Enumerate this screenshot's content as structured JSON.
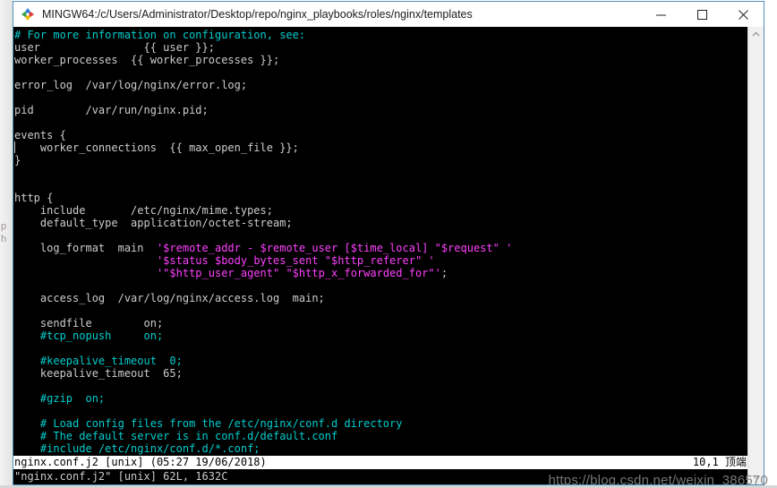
{
  "window": {
    "title": "MINGW64:/c/Users/Administrator/Desktop/repo/nginx_playbooks/roles/nginx/templates",
    "app_icon": "mintty-icon",
    "controls": {
      "minimize": "minimize-button",
      "maximize": "maximize-button",
      "close": "close-button"
    },
    "accent_border": "#4e90b5"
  },
  "terminal": {
    "background": "#000000",
    "foreground": "#cccccc",
    "comment_color": "#00cdcd",
    "string_color": "#ff40ff",
    "cursor": {
      "line": 10,
      "column": 1
    },
    "lines": [
      {
        "n": 1,
        "segments": [
          {
            "t": "# For more information on configuration, see:",
            "c": "comment"
          }
        ]
      },
      {
        "n": 2,
        "segments": [
          {
            "t": "user                {{ user }};",
            "c": "text"
          }
        ]
      },
      {
        "n": 3,
        "segments": [
          {
            "t": "worker_processes  {{ worker_processes }};",
            "c": "text"
          }
        ]
      },
      {
        "n": 4,
        "segments": [
          {
            "t": "",
            "c": "text"
          }
        ]
      },
      {
        "n": 5,
        "segments": [
          {
            "t": "error_log  /var/log/nginx/error.log;",
            "c": "text"
          }
        ]
      },
      {
        "n": 6,
        "segments": [
          {
            "t": "",
            "c": "text"
          }
        ]
      },
      {
        "n": 7,
        "segments": [
          {
            "t": "pid        /var/run/nginx.pid;",
            "c": "text"
          }
        ]
      },
      {
        "n": 8,
        "segments": [
          {
            "t": "",
            "c": "text"
          }
        ]
      },
      {
        "n": 9,
        "segments": [
          {
            "t": "events {",
            "c": "text"
          }
        ]
      },
      {
        "n": 10,
        "segments": [
          {
            "t": "    worker_connections  {{ max_open_file }};",
            "c": "text"
          }
        ]
      },
      {
        "n": 11,
        "segments": [
          {
            "t": "}",
            "c": "text"
          }
        ]
      },
      {
        "n": 12,
        "segments": [
          {
            "t": "",
            "c": "text"
          }
        ]
      },
      {
        "n": 13,
        "segments": [
          {
            "t": "",
            "c": "text"
          }
        ]
      },
      {
        "n": 14,
        "segments": [
          {
            "t": "http {",
            "c": "text"
          }
        ]
      },
      {
        "n": 15,
        "segments": [
          {
            "t": "    include       /etc/nginx/mime.types;",
            "c": "text"
          }
        ]
      },
      {
        "n": 16,
        "segments": [
          {
            "t": "    default_type  application/octet-stream;",
            "c": "text"
          }
        ]
      },
      {
        "n": 17,
        "segments": [
          {
            "t": "",
            "c": "text"
          }
        ]
      },
      {
        "n": 18,
        "segments": [
          {
            "t": "    log_format  main  ",
            "c": "text"
          },
          {
            "t": "'$remote_addr - $remote_user [$time_local] \"$request\" '",
            "c": "string"
          }
        ]
      },
      {
        "n": 19,
        "segments": [
          {
            "t": "                      ",
            "c": "text"
          },
          {
            "t": "'$status $body_bytes_sent \"$http_referer\" '",
            "c": "string"
          }
        ]
      },
      {
        "n": 20,
        "segments": [
          {
            "t": "                      ",
            "c": "text"
          },
          {
            "t": "'\"$http_user_agent\" \"$http_x_forwarded_for\"'",
            "c": "string"
          },
          {
            "t": ";",
            "c": "text"
          }
        ]
      },
      {
        "n": 21,
        "segments": [
          {
            "t": "",
            "c": "text"
          }
        ]
      },
      {
        "n": 22,
        "segments": [
          {
            "t": "    access_log  /var/log/nginx/access.log  main;",
            "c": "text"
          }
        ]
      },
      {
        "n": 23,
        "segments": [
          {
            "t": "",
            "c": "text"
          }
        ]
      },
      {
        "n": 24,
        "segments": [
          {
            "t": "    sendfile        on;",
            "c": "text"
          }
        ]
      },
      {
        "n": 25,
        "segments": [
          {
            "t": "    #tcp_nopush     on;",
            "c": "comment"
          }
        ]
      },
      {
        "n": 26,
        "segments": [
          {
            "t": "",
            "c": "text"
          }
        ]
      },
      {
        "n": 27,
        "segments": [
          {
            "t": "    #keepalive_timeout  0;",
            "c": "comment"
          }
        ]
      },
      {
        "n": 28,
        "segments": [
          {
            "t": "    keepalive_timeout  65;",
            "c": "text"
          }
        ]
      },
      {
        "n": 29,
        "segments": [
          {
            "t": "",
            "c": "text"
          }
        ]
      },
      {
        "n": 30,
        "segments": [
          {
            "t": "    #gzip  on;",
            "c": "comment"
          }
        ]
      },
      {
        "n": 31,
        "segments": [
          {
            "t": "",
            "c": "text"
          }
        ]
      },
      {
        "n": 32,
        "segments": [
          {
            "t": "    # Load config files from the /etc/nginx/conf.d directory",
            "c": "comment"
          }
        ]
      },
      {
        "n": 33,
        "segments": [
          {
            "t": "    # The default server is in conf.d/default.conf",
            "c": "comment"
          }
        ]
      },
      {
        "n": 34,
        "segments": [
          {
            "t": "    #include /etc/nginx/conf.d/*.conf;",
            "c": "comment"
          }
        ]
      }
    ],
    "status_line": {
      "left": "nginx.conf.j2 [unix] (05:27 19/06/2018)",
      "right": "10,1 顶端"
    },
    "command_line": "\"nginx.conf.j2\" [unix] 62L, 1632C"
  },
  "scrollbar": {
    "up_arrow": "chevron-up-icon",
    "down_arrow": "chevron-down-icon"
  },
  "backdrop": {
    "side_text": "p\nh"
  },
  "watermark": {
    "text": "https://blog.csdn.net/weixin_386570"
  }
}
